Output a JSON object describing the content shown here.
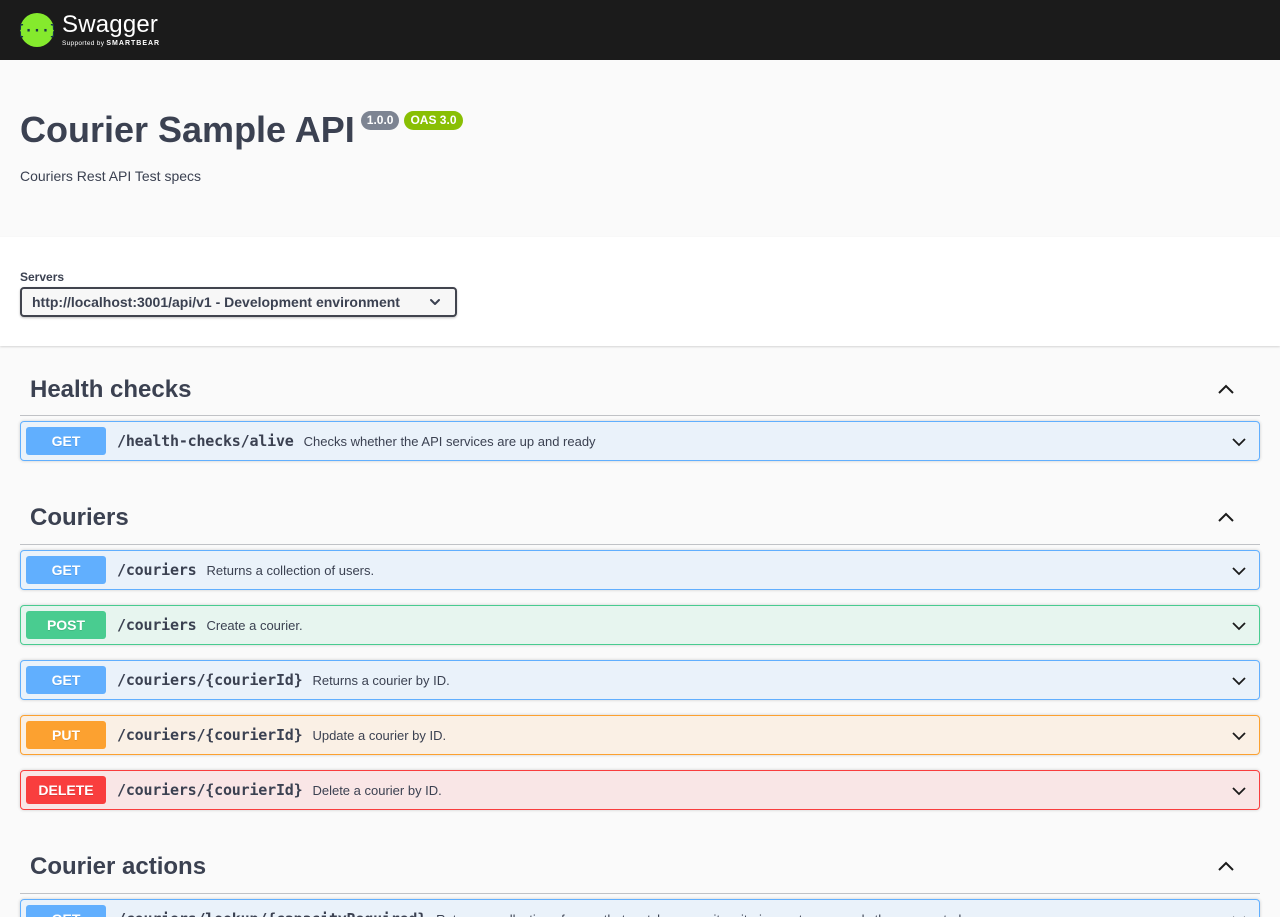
{
  "topbar": {
    "logo_name": "Swagger",
    "logo_supported": "Supported by",
    "logo_brand": "SMARTBEAR",
    "logo_icon": "swagger-braces-icon",
    "colors": {
      "background": "#1b1b1b",
      "logo_green": "#85ea2d"
    }
  },
  "info": {
    "title": "Courier Sample API",
    "version_badge": "1.0.0",
    "oas_badge": "OAS 3.0",
    "description": "Couriers Rest API Test specs"
  },
  "servers": {
    "label": "Servers",
    "selected": "http://localhost:3001/api/v1 - Development environment",
    "chevron_icon": "chevron-down-icon"
  },
  "method_colors": {
    "GET": "#61affe",
    "POST": "#49cc90",
    "PUT": "#fca130",
    "DELETE": "#f93e3e"
  },
  "tags": [
    {
      "name": "Health checks",
      "toggle_icon": "chevron-up-icon",
      "operations": [
        {
          "method": "GET",
          "path": "/health-checks/alive",
          "summary": "Checks whether the API services are up and ready"
        }
      ]
    },
    {
      "name": "Couriers",
      "toggle_icon": "chevron-up-icon",
      "operations": [
        {
          "method": "GET",
          "path": "/couriers",
          "summary": "Returns a collection of users."
        },
        {
          "method": "POST",
          "path": "/couriers",
          "summary": "Create a courier."
        },
        {
          "method": "GET",
          "path": "/couriers/{courierId}",
          "summary": "Returns a courier by ID."
        },
        {
          "method": "PUT",
          "path": "/couriers/{courierId}",
          "summary": "Update a courier by ID."
        },
        {
          "method": "DELETE",
          "path": "/couriers/{courierId}",
          "summary": "Delete a courier by ID."
        }
      ]
    },
    {
      "name": "Courier actions",
      "toggle_icon": "chevron-up-icon",
      "operations": [
        {
          "method": "GET",
          "path": "/couriers/lookup/{capacityRequired}",
          "summary": "Returns a collection of users that match a capacity criteria greater or equals than requested."
        }
      ]
    }
  ]
}
